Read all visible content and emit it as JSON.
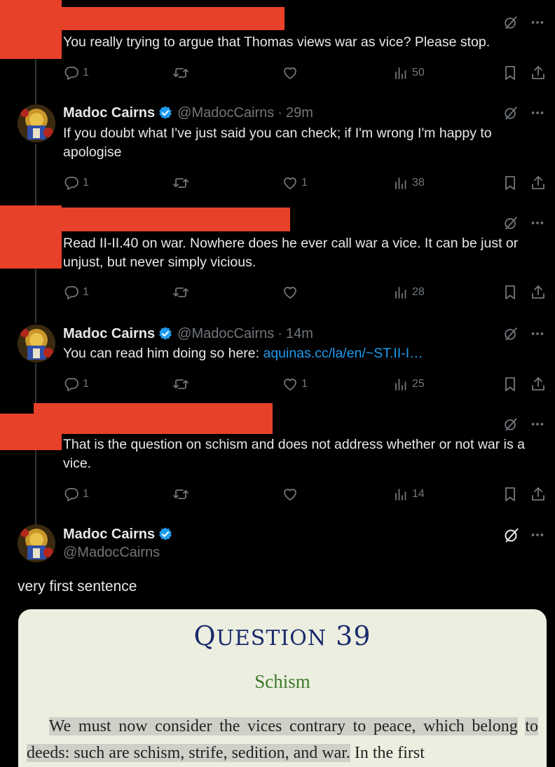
{
  "tweets": [
    {
      "redacted": true,
      "text": "You really trying to argue that Thomas views war as vice? Please stop.",
      "replies": "1",
      "retweets": "",
      "likes": "",
      "views": "50"
    },
    {
      "redacted": false,
      "name": "Madoc Cairns",
      "handle": "@MadocCairns",
      "time": "29m",
      "text": "If you doubt what I've just said you can check; if I'm wrong I'm happy to apologise",
      "replies": "1",
      "retweets": "",
      "likes": "1",
      "views": "38"
    },
    {
      "redacted": true,
      "text": "Read II-II.40 on war. Nowhere does he ever call war a vice. It can be just or unjust, but never simply vicious.",
      "replies": "1",
      "retweets": "",
      "likes": "",
      "views": "28"
    },
    {
      "redacted": false,
      "name": "Madoc Cairns",
      "handle": "@MadocCairns",
      "time": "14m",
      "text_prefix": "You can read him doing so here: ",
      "link": "aquinas.cc/la/en/~ST.II-I…",
      "replies": "1",
      "retweets": "",
      "likes": "1",
      "views": "25"
    },
    {
      "redacted": true,
      "text": "That is the question on schism and does not address whether or not war is a vice.",
      "replies": "1",
      "retweets": "",
      "likes": "",
      "views": "14"
    }
  ],
  "focused": {
    "name": "Madoc Cairns",
    "handle": "@MadocCairns",
    "text": "very first sentence"
  },
  "image": {
    "title_big": "Q",
    "title_small": "UESTION",
    "title_num": "39",
    "subtitle": "Schism",
    "body_highlight_1": "We must now consider the vices contrary to peace, which belong",
    "body_highlight_2": "to deeds: such are schism, strife, sedition, and war.",
    "body_rest": " In the first"
  },
  "colors": {
    "background": "#000000",
    "redaction": "#e8412a",
    "link": "#1d9bf0",
    "muted": "#71767b",
    "verified": "#1d9bf0"
  },
  "icons": [
    "reply-icon",
    "retweet-icon",
    "like-icon",
    "views-icon",
    "bookmark-icon",
    "share-icon",
    "grok-icon",
    "more-icon",
    "verified-badge-icon"
  ]
}
